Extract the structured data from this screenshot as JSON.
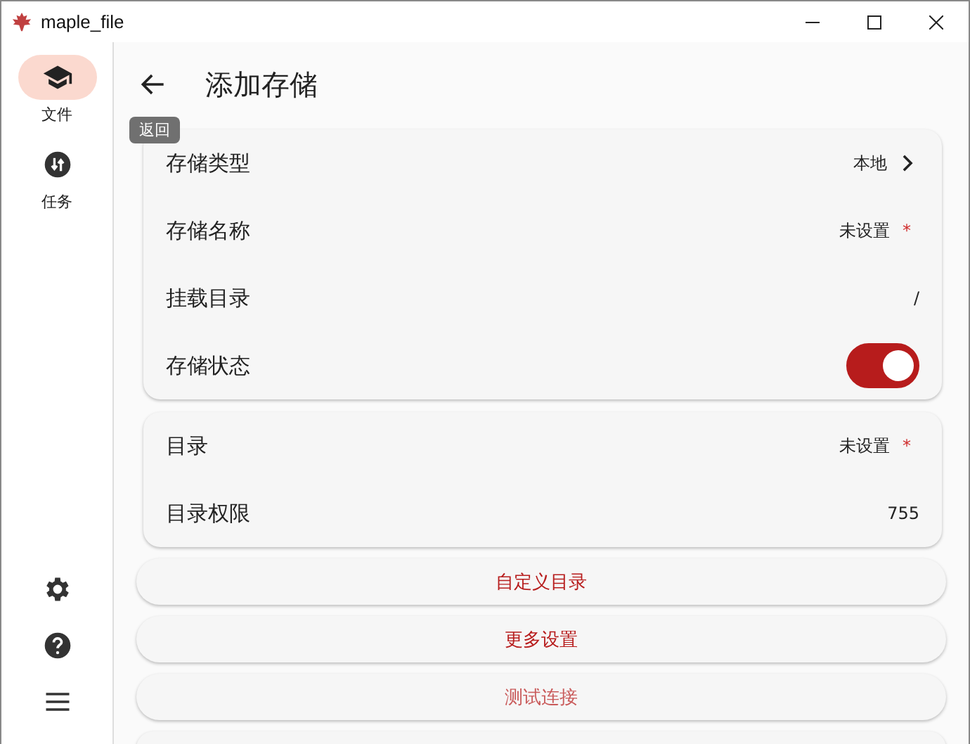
{
  "window": {
    "title": "maple_file"
  },
  "sidebar": {
    "items": [
      {
        "label": "文件",
        "kind": "files",
        "selected": true
      },
      {
        "label": "任务",
        "kind": "tasks",
        "selected": false
      }
    ],
    "bottom_icons": [
      {
        "kind": "settings"
      },
      {
        "kind": "help"
      },
      {
        "kind": "menu"
      }
    ]
  },
  "header": {
    "title": "添加存储",
    "tooltip": "返回"
  },
  "cards": [
    {
      "rows": [
        {
          "label": "存储类型",
          "kind": "link",
          "value": "本地"
        },
        {
          "label": "存储名称",
          "kind": "required",
          "value": "未设置",
          "required_mark": "*"
        },
        {
          "label": "挂载目录",
          "kind": "text",
          "value": "/"
        },
        {
          "label": "存储状态",
          "kind": "switch",
          "on": true
        }
      ]
    },
    {
      "rows": [
        {
          "label": "目录",
          "kind": "required",
          "value": "未设置",
          "required_mark": "*"
        },
        {
          "label": "目录权限",
          "kind": "text",
          "value": "755"
        }
      ]
    }
  ],
  "buttons": [
    {
      "label": "自定义目录",
      "disabled": false
    },
    {
      "label": "更多设置",
      "disabled": false
    },
    {
      "label": "测试连接",
      "disabled": true
    },
    {
      "kind": "cut_off"
    }
  ]
}
